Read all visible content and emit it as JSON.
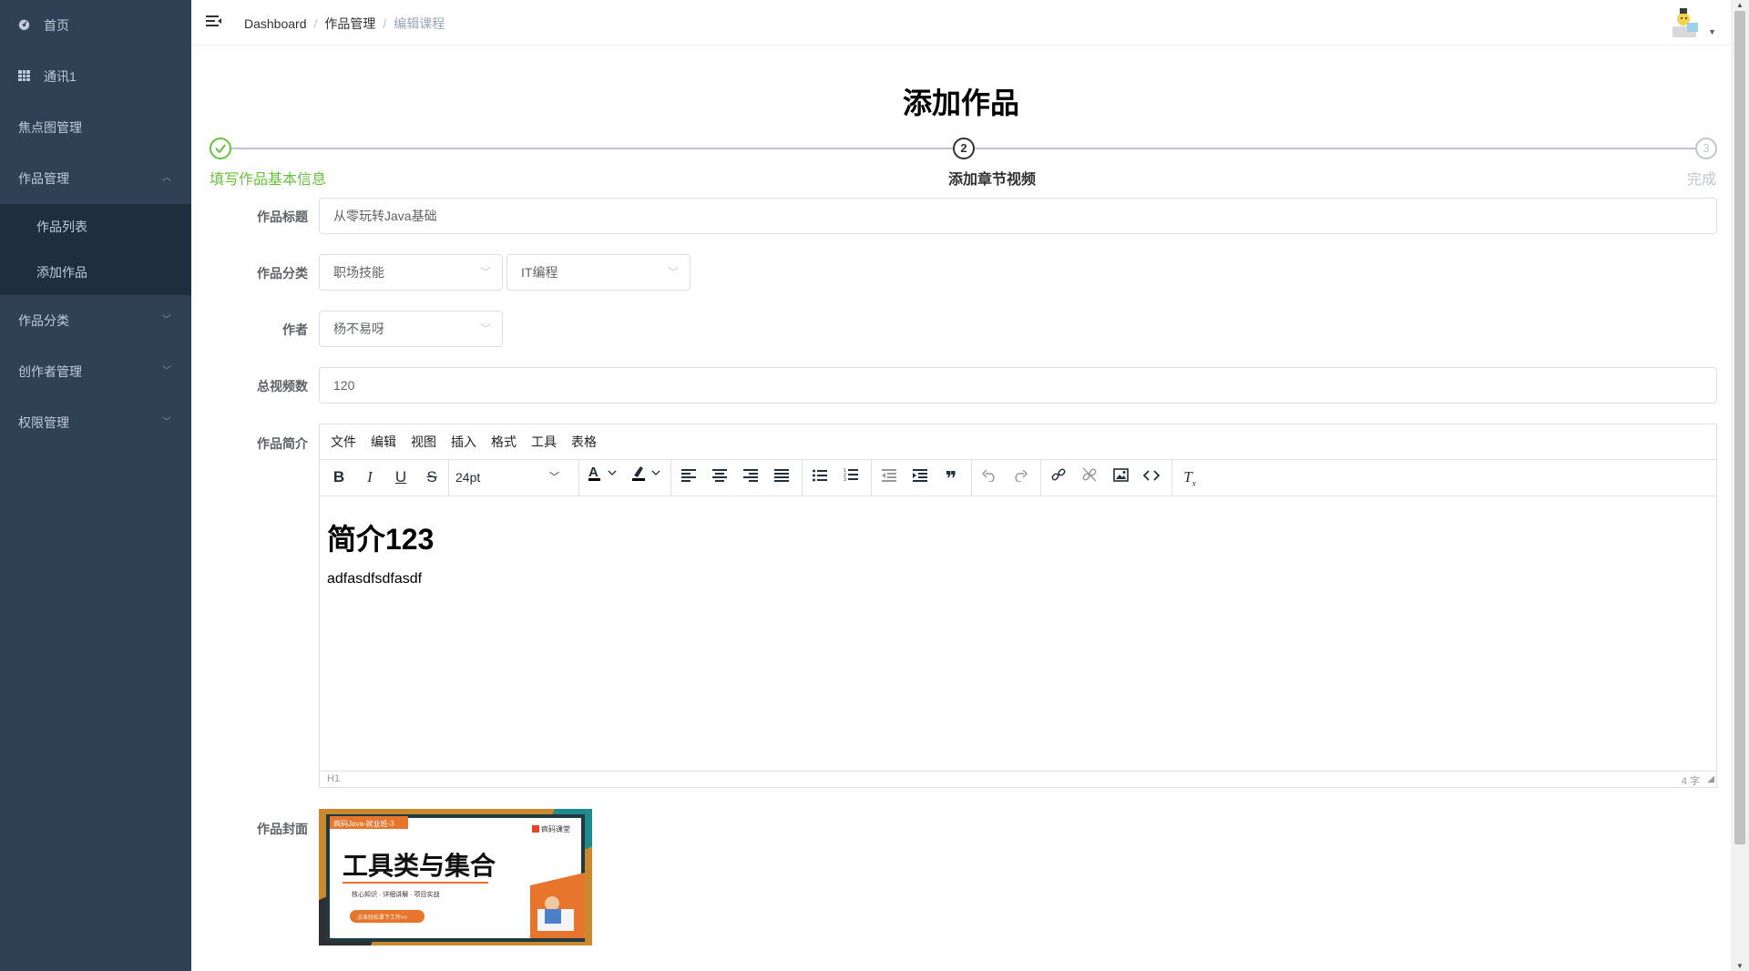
{
  "sidebar": {
    "items": [
      {
        "label": "首页",
        "icon": "dashboard-icon"
      },
      {
        "label": "通讯1",
        "icon": "grid-icon"
      },
      {
        "label": "焦点图管理"
      },
      {
        "label": "作品管理",
        "expanded": true
      },
      {
        "label": "作品分类"
      },
      {
        "label": "创作者管理"
      },
      {
        "label": "权限管理"
      }
    ],
    "sub_items": [
      "作品列表",
      "添加作品"
    ]
  },
  "breadcrumb": [
    "Dashboard",
    "作品管理",
    "编辑课程"
  ],
  "page_title": "添加作品",
  "steps": [
    {
      "number": "1",
      "title": "填写作品基本信息",
      "status": "done"
    },
    {
      "number": "2",
      "title": "添加章节视频",
      "status": "process"
    },
    {
      "number": "3",
      "title": "完成",
      "status": "wait"
    }
  ],
  "form": {
    "title_label": "作品标题",
    "title_value": "从零玩转Java基础",
    "category_label": "作品分类",
    "category_level1": "职场技能",
    "category_level2": "IT编程",
    "author_label": "作者",
    "author_value": "杨不易呀",
    "video_count_label": "总视频数",
    "video_count_value": "120",
    "intro_label": "作品简介",
    "cover_label": "作品封面"
  },
  "editor": {
    "menubar": [
      "文件",
      "编辑",
      "视图",
      "插入",
      "格式",
      "工具",
      "表格"
    ],
    "font_size": "24pt",
    "heading": "简介123",
    "paragraph": "adfasdfsdfasdf",
    "status_path": "H1",
    "word_count": "4 字"
  },
  "cover_image": {
    "tag": "疯码Java-就业班-3",
    "brand": "疯码课堂",
    "headline": "工具类与集合",
    "subline": "核心知识 · 详细讲解 · 项目实战",
    "button": "点击轻松拿下工作>>"
  },
  "colors": {
    "sidebar_bg": "#304156",
    "submenu_bg": "#1f2d3d",
    "step_done": "#67c23a",
    "border": "#dcdfe6"
  }
}
